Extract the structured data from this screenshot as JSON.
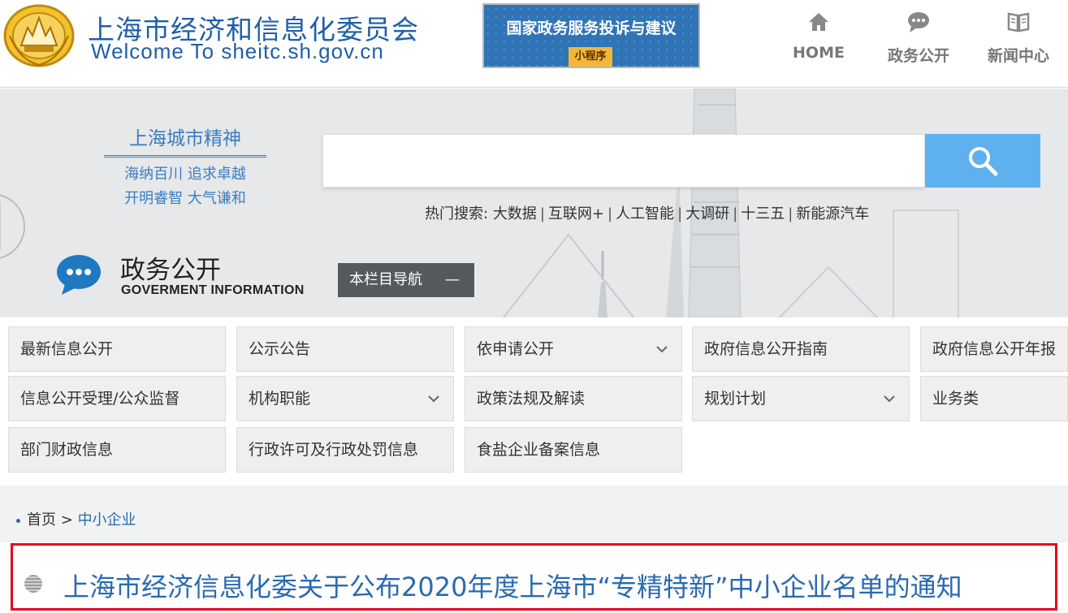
{
  "header": {
    "site_title": "上海市经济和信息化委员会",
    "site_subtitle": "Welcome To sheitc.sh.gov.cn",
    "banner": {
      "title": "国家政务服务投诉与建议",
      "tag": "小程序"
    },
    "nav": [
      {
        "label": "HOME",
        "icon": "home-icon"
      },
      {
        "label": "政务公开",
        "icon": "chat-icon"
      },
      {
        "label": "新闻中心",
        "icon": "book-icon"
      }
    ]
  },
  "hero": {
    "spirit": {
      "title": "上海城市精神",
      "line1": "海纳百川 追求卓越",
      "line2": "开明睿智 大气谦和"
    },
    "search": {
      "value": "",
      "placeholder": ""
    },
    "hot_search": {
      "label": "热门搜索:",
      "items": [
        "大数据",
        "互联网+",
        "人工智能",
        "大调研",
        "十三五",
        "新能源汽车"
      ],
      "separator": "|"
    },
    "section": {
      "title": "政务公开",
      "subtitle": "GOVERMENT INFORMATION",
      "column_nav": "本栏目导航",
      "column_nav_toggle": "—"
    }
  },
  "categories": [
    {
      "label": "最新信息公开",
      "dropdown": false
    },
    {
      "label": "公示公告",
      "dropdown": false
    },
    {
      "label": "依申请公开",
      "dropdown": true
    },
    {
      "label": "政府信息公开指南",
      "dropdown": false
    },
    {
      "label": "政府信息公开年报",
      "dropdown": false
    },
    {
      "label": "信息公开受理/公众监督",
      "dropdown": false
    },
    {
      "label": "机构职能",
      "dropdown": true
    },
    {
      "label": "政策法规及解读",
      "dropdown": false
    },
    {
      "label": "规划计划",
      "dropdown": true
    },
    {
      "label": "业务类",
      "dropdown": false
    },
    {
      "label": "部门财政信息",
      "dropdown": false
    },
    {
      "label": "行政许可及行政处罚信息",
      "dropdown": false
    },
    {
      "label": "食盐企业备案信息",
      "dropdown": false
    }
  ],
  "breadcrumb": {
    "home": "首页",
    "separator": ">",
    "current": "中小企业"
  },
  "article": {
    "title": "上海市经济信息化委关于公布2020年度上海市“专精特新”中小企业名单的通知"
  },
  "colors": {
    "brand_blue": "#1f5fa8",
    "search_blue": "#5fb0ef",
    "highlight_red": "#e8001c",
    "nav_dark": "#55595d"
  }
}
